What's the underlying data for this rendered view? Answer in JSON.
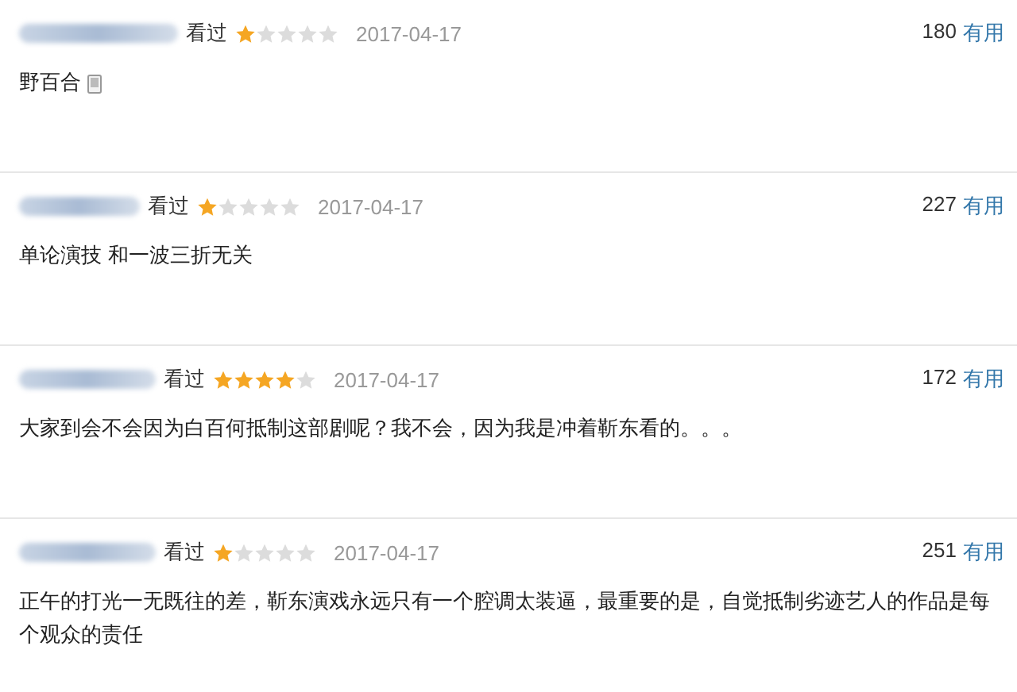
{
  "comments": [
    {
      "status": "看过",
      "stars": 1,
      "date": "2017-04-17",
      "votes": "180",
      "useful": "有用",
      "text": "野百合",
      "mobile_icon": true
    },
    {
      "status": "看过",
      "stars": 1,
      "date": "2017-04-17",
      "votes": "227",
      "useful": "有用",
      "text": "单论演技 和一波三折无关",
      "mobile_icon": false
    },
    {
      "status": "看过",
      "stars": 4,
      "date": "2017-04-17",
      "votes": "172",
      "useful": "有用",
      "text": "大家到会不会因为白百何抵制这部剧呢？我不会，因为我是冲着靳东看的。。。",
      "mobile_icon": false
    },
    {
      "status": "看过",
      "stars": 1,
      "date": "2017-04-17",
      "votes": "251",
      "useful": "有用",
      "text": "正午的打光一无既往的差，靳东演戏永远只有一个腔调太装逼，最重要的是，自觉抵制劣迹艺人的作品是每个观众的责任",
      "mobile_icon": false
    }
  ]
}
